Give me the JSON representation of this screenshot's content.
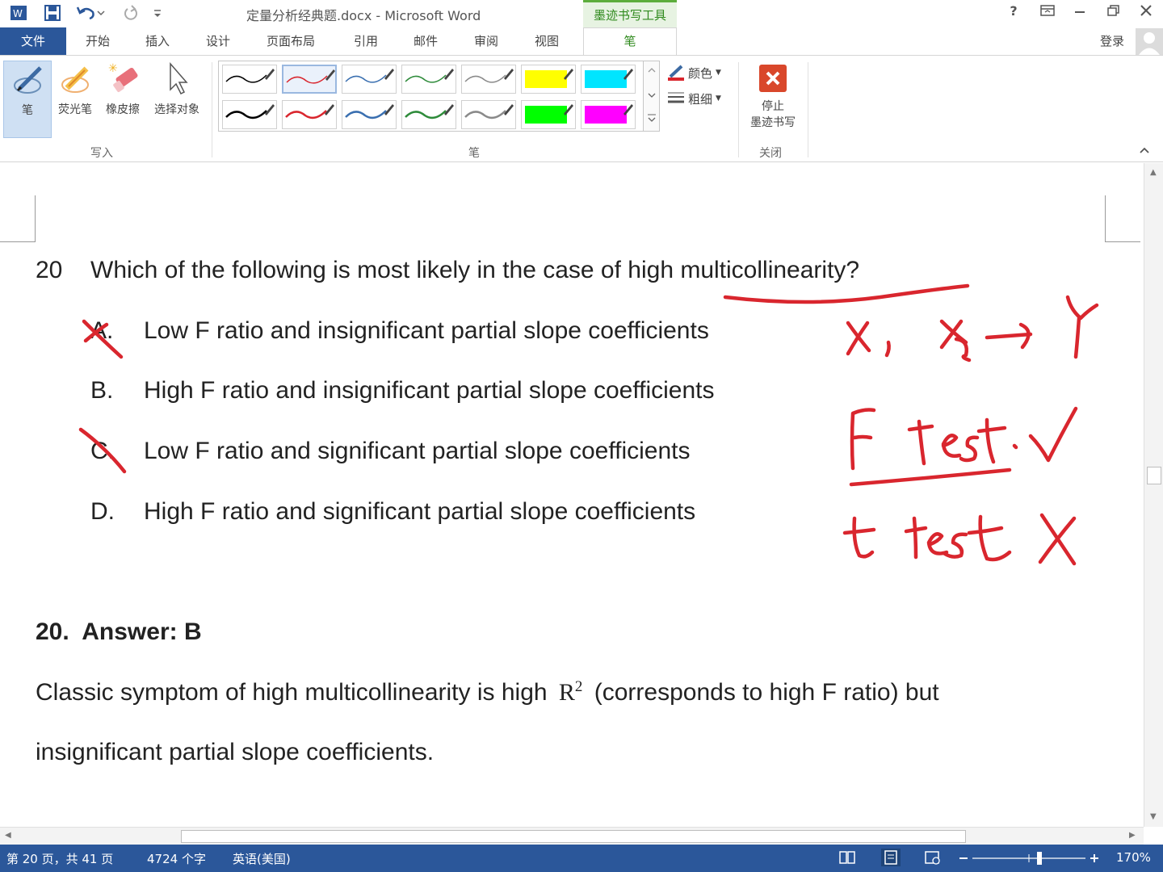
{
  "titlebar": {
    "doc_title": "定量分析经典题.docx - Microsoft Word",
    "context_tab": "墨迹书写工具",
    "help": "?",
    "icons": [
      "word-logo-icon",
      "save-icon",
      "undo-icon",
      "redo-icon",
      "customize-quick-access-icon"
    ]
  },
  "tabs": {
    "file": "文件",
    "items": [
      "开始",
      "插入",
      "设计",
      "页面布局",
      "引用",
      "邮件",
      "审阅",
      "视图"
    ],
    "active": "笔",
    "login": "登录"
  },
  "ribbon": {
    "write_group": {
      "label": "写入",
      "tools": [
        "笔",
        "荧光笔",
        "橡皮擦",
        "选择对象"
      ]
    },
    "pens_group": {
      "label": "笔",
      "pen_colors_row1": [
        "#000000",
        "#d9262e",
        "#3a6fb0",
        "#2e8b3a",
        "#8a8a8a",
        "#ffff00",
        "#00e5ff"
      ],
      "pen_colors_row2": [
        "#000000",
        "#d9262e",
        "#3a6fb0",
        "#2e8b3a",
        "#8a8a8a",
        "#00ff00",
        "#ff00ff"
      ],
      "color_label": "颜色",
      "thickness_label": "粗细"
    },
    "close_group": {
      "label": "关闭",
      "stop_line1": "停止",
      "stop_line2": "墨迹书写"
    }
  },
  "document": {
    "question_number": "20",
    "question_text": "Which of the following is most likely in the case of high multicollinearity?",
    "options": [
      {
        "letter": "A.",
        "text": "Low F ratio and insignificant partial slope coefficients"
      },
      {
        "letter": "B.",
        "text": "High F ratio and insignificant partial slope coefficients"
      },
      {
        "letter": "C.",
        "text": "Low F ratio and significant partial slope coefficients"
      },
      {
        "letter": "D.",
        "text": "High F ratio and significant partial slope coefficients"
      }
    ],
    "answer_heading": "20.  Answer: B",
    "explanation_line1_pre": "Classic symptom of high multicollinearity is high ",
    "explanation_r": "R",
    "explanation_sup": "2",
    "explanation_line1_post": " (corresponds to high F ratio) but",
    "explanation_line2": "insignificant partial slope coefficients."
  },
  "ink_annotations": {
    "color": "#d9262e"
  },
  "statusbar": {
    "page": "第 20 页，共 41 页",
    "words": "4724 个字",
    "language": "英语(美国)",
    "zoom": "170%"
  }
}
